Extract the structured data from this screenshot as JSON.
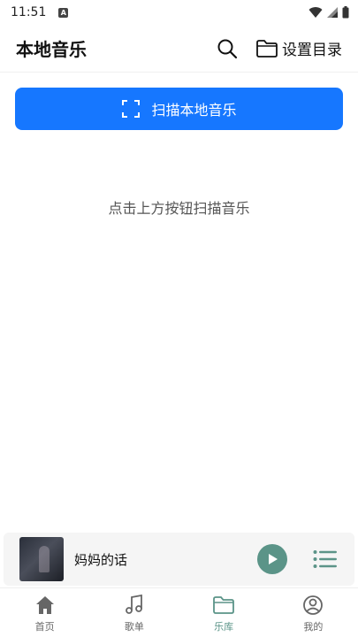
{
  "status_bar": {
    "time": "11:51",
    "notif_icon": "A"
  },
  "header": {
    "title": "本地音乐",
    "search_icon": "search-icon",
    "set_dir_label": "设置目录"
  },
  "scan": {
    "label": "扫描本地音乐",
    "icon": "scan-frame-icon",
    "color": "#1677ff"
  },
  "empty_hint": "点击上方按钮扫描音乐",
  "player": {
    "song_title": "妈妈的话",
    "accent": "#5b9488"
  },
  "tabs": [
    {
      "label": "首页",
      "icon": "home-icon",
      "active": false
    },
    {
      "label": "歌单",
      "icon": "music-note-icon",
      "active": false
    },
    {
      "label": "乐库",
      "icon": "folder-icon",
      "active": true
    },
    {
      "label": "我的",
      "icon": "user-icon",
      "active": false
    }
  ]
}
